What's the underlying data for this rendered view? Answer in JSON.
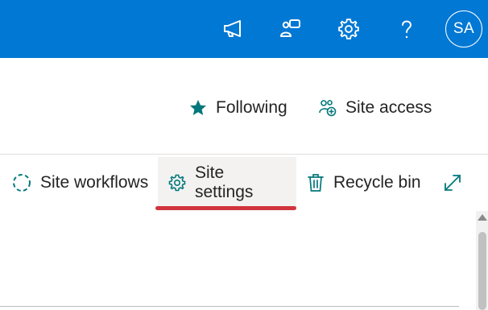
{
  "suitebar": {
    "background": "#0078d4",
    "icons": [
      "megaphone-icon",
      "chat-icon",
      "gear-icon",
      "help-icon"
    ],
    "avatar_initials": "SA"
  },
  "header_actions": {
    "following_label": "Following",
    "site_access_label": "Site access"
  },
  "command_bar": {
    "site_workflows_label": "Site workflows",
    "site_settings_label": "Site settings",
    "recycle_bin_label": "Recycle bin",
    "expand_icon": "expand-icon",
    "active_item": "Site settings",
    "active_underline_color": "#d1343b"
  },
  "colors": {
    "accent": "#0078d4",
    "teal_icon": "#03787c",
    "text": "#242424"
  }
}
